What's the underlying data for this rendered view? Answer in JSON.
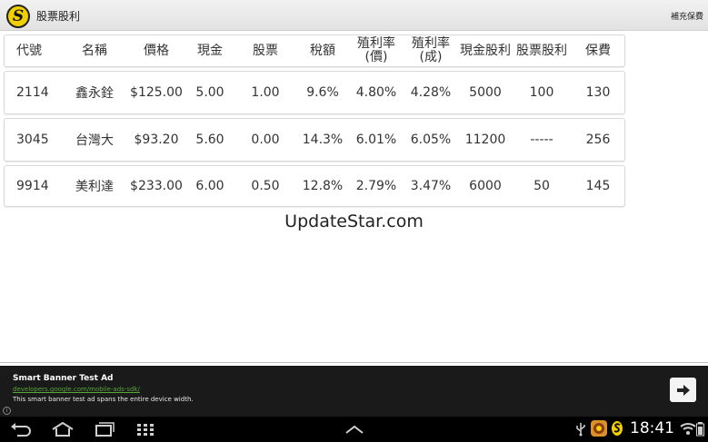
{
  "app": {
    "title": "股票股利",
    "menu_action": "補充保費",
    "logo_glyph": "S"
  },
  "table": {
    "headers": [
      "代號",
      "名稱",
      "價格",
      "現金",
      "股票",
      "稅額",
      "殖利率\n(價)",
      "殖利率\n(成)",
      "現金股利",
      "股票股利",
      "保費"
    ],
    "rows": [
      [
        "2114",
        "鑫永銓",
        "$125.00",
        "5.00",
        "1.00",
        "9.6%",
        "4.80%",
        "4.28%",
        "5000",
        "100",
        "130"
      ],
      [
        "3045",
        "台灣大",
        "$93.20",
        "5.60",
        "0.00",
        "14.3%",
        "6.01%",
        "6.05%",
        "11200",
        "-----",
        "256"
      ],
      [
        "9914",
        "美利達",
        "$233.00",
        "6.00",
        "0.50",
        "12.8%",
        "2.79%",
        "3.47%",
        "6000",
        "50",
        "145"
      ]
    ]
  },
  "watermark": "UpdateStar.com",
  "ad": {
    "title": "Smart Banner Test Ad",
    "url": "developers.google.com/mobile-ads-sdk/",
    "description": "This smart banner test ad spans the entire device width.",
    "info_glyph": "i"
  },
  "system_bar": {
    "time": "18:41"
  },
  "colors": {
    "ad_background": "#1a1a1a",
    "ad_url": "#58a63a",
    "system_bar": "#000000",
    "logo_yellow": "#f2cf00"
  },
  "icons": [
    "back-icon",
    "home-icon",
    "recent-apps-icon",
    "apps-grid-icon",
    "chevron-up-icon",
    "usb-icon",
    "notification-app-icon",
    "stock-app-icon",
    "wifi-icon",
    "arrow-right-icon"
  ]
}
